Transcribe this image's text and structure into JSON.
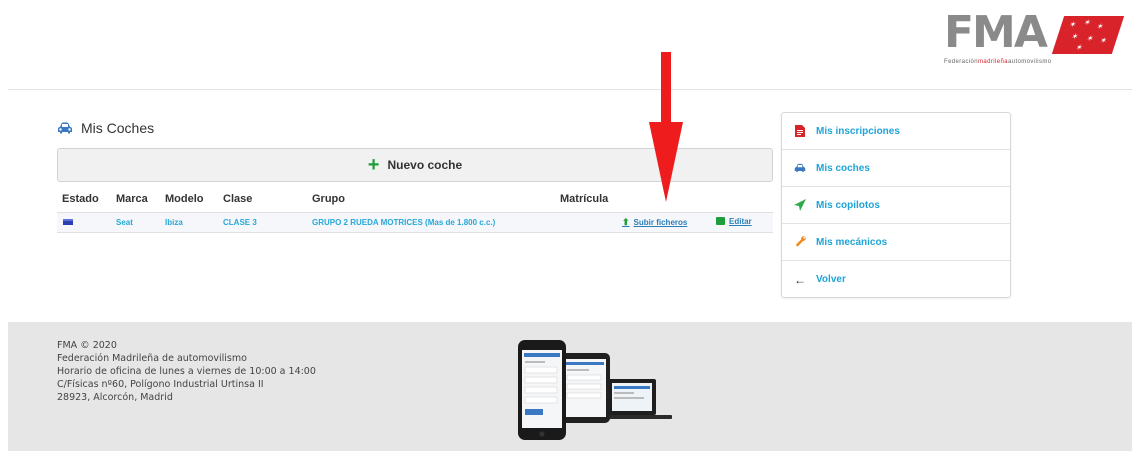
{
  "header": {
    "logo_text": "FMA",
    "logo_tagline_start": "Federación",
    "logo_tagline_red": "madrileña",
    "logo_tagline_end": "automovilismo"
  },
  "main": {
    "section_title": "Mis Coches",
    "new_car_label": "Nuevo coche",
    "table": {
      "columns": [
        "Estado",
        "Marca",
        "Modelo",
        "Clase",
        "Grupo",
        "Matrícula"
      ],
      "rows": [
        {
          "marca": "Seat",
          "modelo": "Ibiza",
          "clase": "CLASE 3",
          "grupo": "GRUPO 2 RUEDA MOTRICES (Mas de 1.800 c.c.)",
          "matricula": "",
          "upload_label": "Subir ficheros",
          "edit_label": "Editar"
        }
      ]
    }
  },
  "sidebar": {
    "items": [
      {
        "label": "Mis inscripciones",
        "icon": "document-icon"
      },
      {
        "label": "Mis coches",
        "icon": "car-icon"
      },
      {
        "label": "Mis copilotos",
        "icon": "paper-plane-icon"
      },
      {
        "label": "Mis mecánicos",
        "icon": "wrench-icon"
      },
      {
        "label": "Volver",
        "icon": "arrow-left-icon"
      }
    ]
  },
  "footer": {
    "lines": [
      "FMA © 2020",
      "Federación Madrileña de automovilismo",
      "Horario de oficina de lunes a viernes de 10:00 a 14:00",
      "C/Físicas nº60, Polígono Industrial Urtinsa II",
      "28923, Alcorcón, Madrid"
    ]
  },
  "colors": {
    "link": "#1fa4d8",
    "accent_green": "#1e9e3a",
    "brand_red": "#d9232a",
    "footer_bg": "#e6e6e6"
  }
}
